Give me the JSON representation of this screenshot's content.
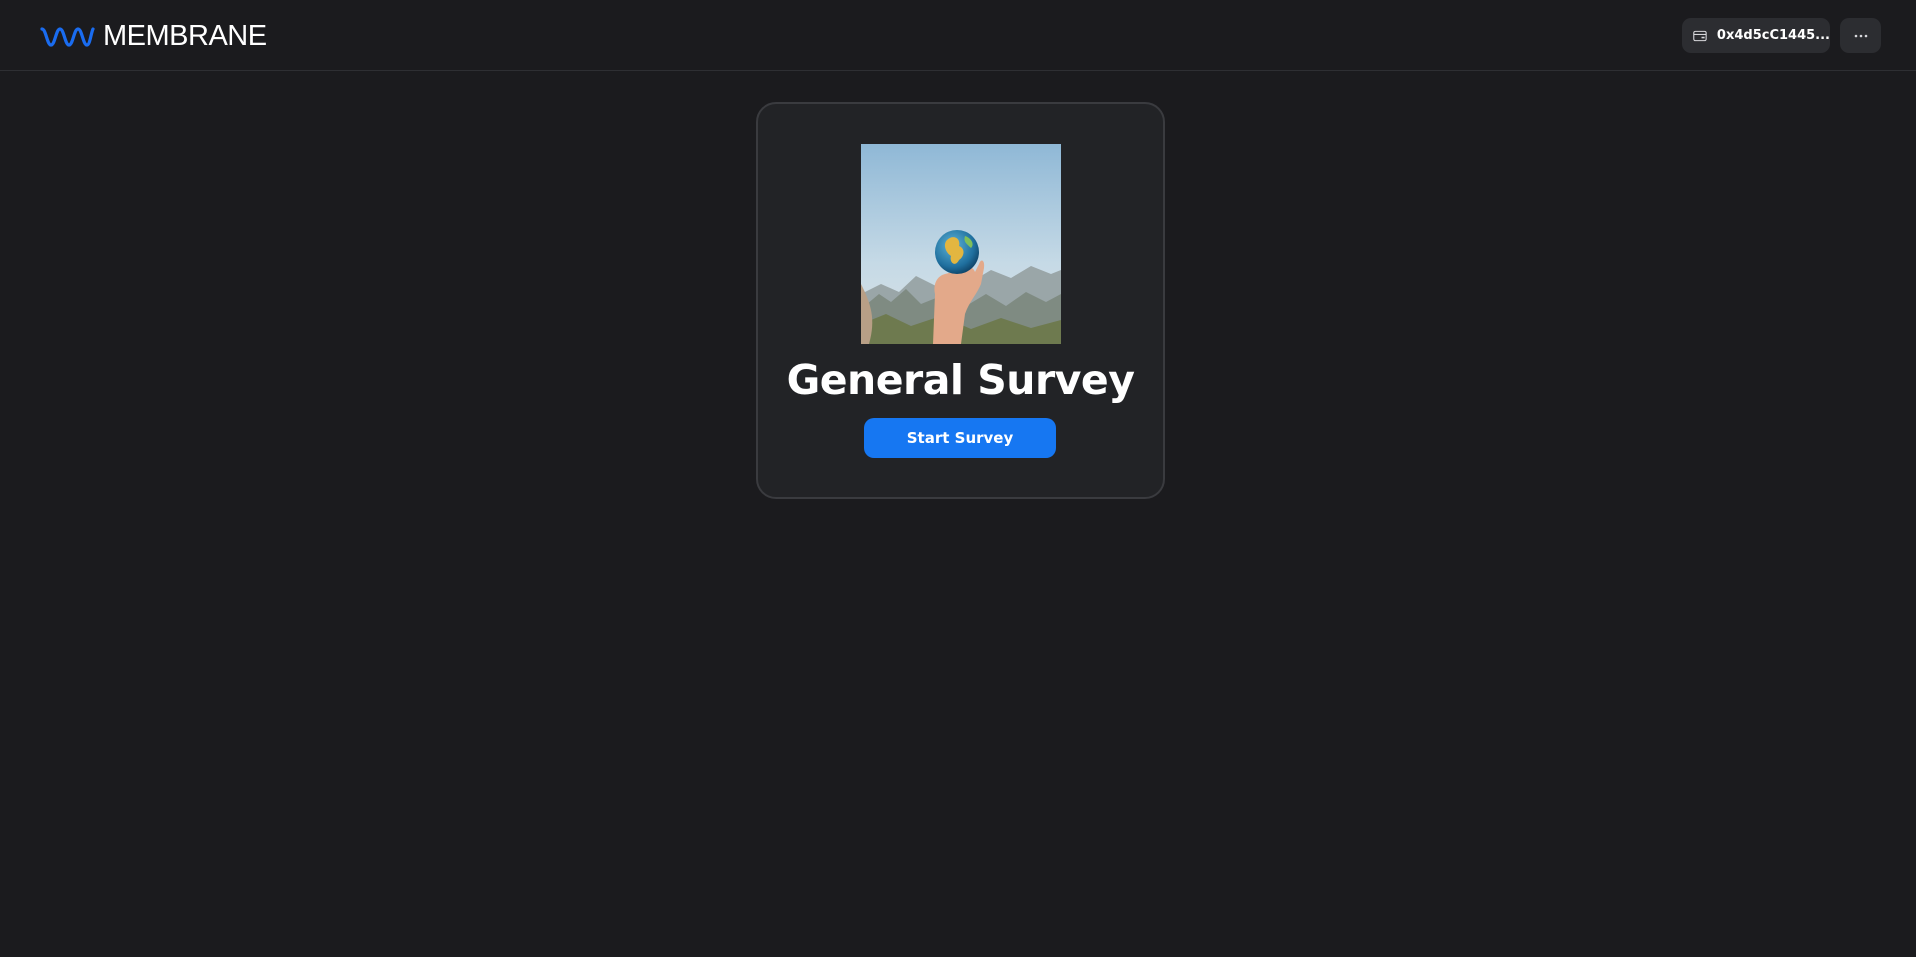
{
  "header": {
    "brand_name": "MEMBRANE",
    "logo_icon": "membrane-wave-logo",
    "wallet_icon": "wallet-icon",
    "wallet_address": "0x4d5cC1445...",
    "more_icon": "ellipsis-icon"
  },
  "survey": {
    "image_alt": "Hand holding a globe",
    "title": "General Survey",
    "start_button_label": "Start Survey"
  },
  "colors": {
    "background": "#1b1b1e",
    "card_background": "#222326",
    "accent_blue": "#1677f2",
    "logo_blue": "#1a6cf0",
    "button_gray": "#2c2d31"
  }
}
